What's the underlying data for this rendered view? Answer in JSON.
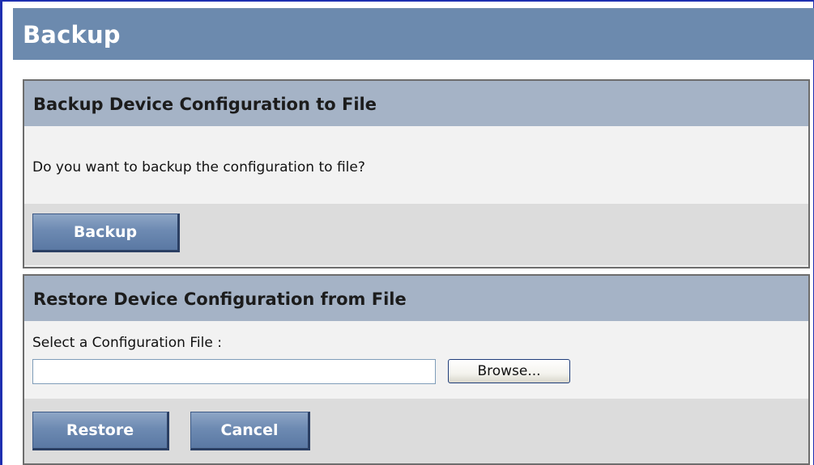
{
  "page": {
    "title": "Backup"
  },
  "backup_section": {
    "title": "Backup Device Configuration to File",
    "prompt": "Do you want to backup the configuration to file?",
    "backup_button": "Backup"
  },
  "restore_section": {
    "title": "Restore Device Configuration from File",
    "file_label": "Select a Configuration File :",
    "file_value": "",
    "browse_button": "Browse...",
    "restore_button": "Restore",
    "cancel_button": "Cancel"
  },
  "colors": {
    "header_bg": "#6c8aae",
    "panel_title_bg": "#a5b3c6",
    "button_bg": "#6d8ab2",
    "frame_border": "#1e2fb0"
  }
}
